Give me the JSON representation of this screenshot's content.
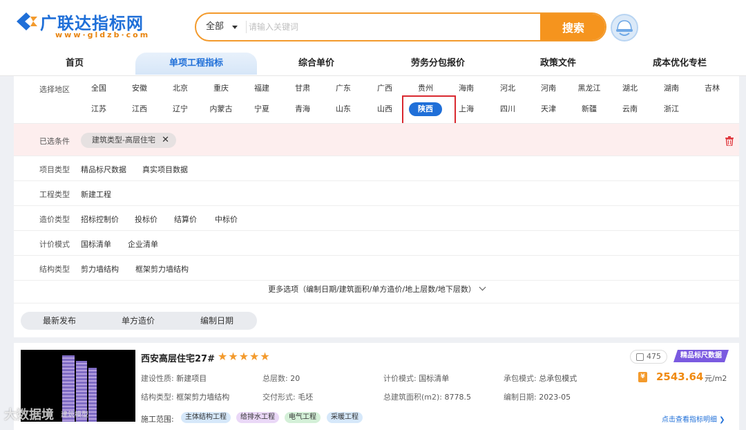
{
  "header": {
    "logo_text": "广联达指标网",
    "logo_sub": "www·gldzb·com",
    "search_scope": "全部",
    "search_placeholder": "请输入关键词",
    "search_button": "搜索"
  },
  "nav": {
    "items": [
      "首页",
      "单项工程指标",
      "综合单价",
      "劳务分包报价",
      "政策文件",
      "成本优化专栏"
    ],
    "active_index": 1
  },
  "region": {
    "label": "选择地区",
    "row1": [
      "全国",
      "安徽",
      "北京",
      "重庆",
      "福建",
      "甘肃",
      "广东",
      "广西",
      "贵州",
      "海南",
      "河北",
      "河南",
      "黑龙江",
      "湖北",
      "湖南",
      "吉林"
    ],
    "row2": [
      "江苏",
      "江西",
      "辽宁",
      "内蒙古",
      "宁夏",
      "青海",
      "山东",
      "山西",
      "陕西",
      "上海",
      "四川",
      "天津",
      "新疆",
      "云南",
      "浙江"
    ],
    "active": "陕西"
  },
  "selected": {
    "label": "已选条件",
    "chip": "建筑类型-高层住宅",
    "chip_close": "✕"
  },
  "filters": [
    {
      "label": "项目类型",
      "options": [
        "精品标尺数据",
        "真实项目数据"
      ]
    },
    {
      "label": "工程类型",
      "options": [
        "新建工程"
      ]
    },
    {
      "label": "造价类型",
      "options": [
        "招标控制价",
        "投标价",
        "结算价",
        "中标价"
      ]
    },
    {
      "label": "计价模式",
      "options": [
        "国标清单",
        "企业清单"
      ]
    },
    {
      "label": "结构类型",
      "options": [
        "剪力墙结构",
        "框架剪力墙结构"
      ]
    }
  ],
  "more_options": "更多选项（编制日期/建筑面积/单方造价/地上层数/地下层数）",
  "sort": {
    "items": [
      "最新发布",
      "单方造价",
      "编制日期"
    ]
  },
  "card": {
    "title": "西安高层住宅27#",
    "stars": "★★★★★",
    "likes": "475",
    "tag": "精品标尺数据",
    "fields": {
      "nature_label": "建设性质:",
      "nature": "新建项目",
      "floors_label": "总层数:",
      "floors": "20",
      "pricing_label": "计价模式:",
      "pricing": "国标清单",
      "contract_label": "承包模式:",
      "contract": "总承包模式",
      "structure_label": "结构类型:",
      "structure": "框架剪力墙结构",
      "delivery_label": "交付形式:",
      "delivery": "毛坯",
      "area_label": "总建筑面积(m2):",
      "area": "8778.5",
      "date_label": "编制日期:",
      "date": "2023-05"
    },
    "price": "2543.64",
    "price_unit": "元/m2",
    "scope_label": "施工范围:",
    "scope_tags": [
      "主体结构工程",
      "给排水工程",
      "电气工程",
      "采暖工程"
    ],
    "detail_link": "点击查看指标明细 ❯",
    "thumb_caption": "建筑模型"
  },
  "watermark": "大数据境",
  "colors": {
    "brand_blue": "#1f6fd8",
    "brand_orange": "#f5941e",
    "highlight_red": "#d9282f",
    "premium_purple": "#7a5ae0"
  }
}
